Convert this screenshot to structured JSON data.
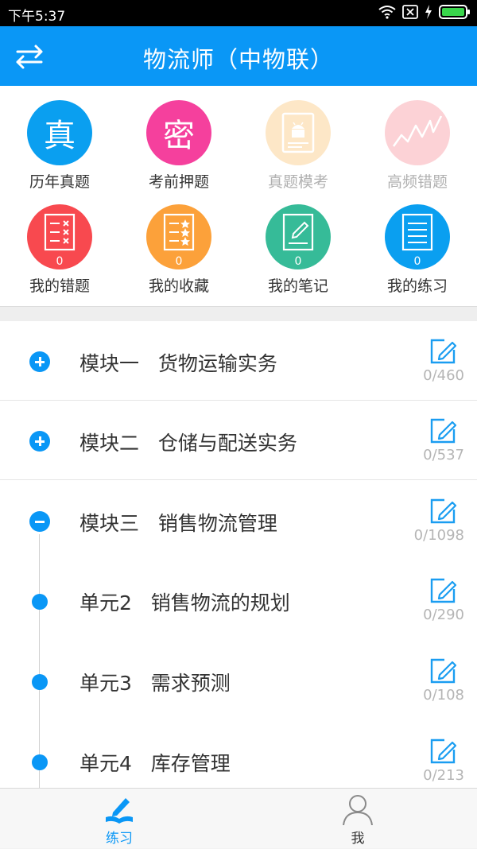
{
  "status": {
    "time": "下午5:37"
  },
  "header": {
    "title": "物流师（中物联）"
  },
  "colors": {
    "accent": "#0a97f6"
  },
  "grid": [
    {
      "label": "历年真题",
      "char": "真",
      "color": "#0a9ff0",
      "disabled": false
    },
    {
      "label": "考前押题",
      "char": "密",
      "color": "#f5409d",
      "disabled": false
    },
    {
      "label": "真题模考",
      "char": "",
      "color": "#fde7c7",
      "disabled": true
    },
    {
      "label": "高频错题",
      "char": "",
      "color": "#fcd2d6",
      "disabled": true
    },
    {
      "label": "我的错题",
      "badge": "0",
      "color": "#f8494f",
      "disabled": false
    },
    {
      "label": "我的收藏",
      "badge": "0",
      "color": "#fca13a",
      "disabled": false
    },
    {
      "label": "我的笔记",
      "badge": "0",
      "color": "#36bb98",
      "disabled": false
    },
    {
      "label": "我的练习",
      "badge": "0",
      "color": "#0a9ff0",
      "disabled": false
    }
  ],
  "modules": [
    {
      "label": "模块一   货物运输实务",
      "count": "0/460",
      "state": "plus"
    },
    {
      "label": "模块二   仓储与配送实务",
      "count": "0/537",
      "state": "plus"
    },
    {
      "label": "模块三   销售物流管理",
      "count": "0/1098",
      "state": "minus"
    },
    {
      "label": "单元2   销售物流的规划",
      "count": "0/290",
      "state": "dot"
    },
    {
      "label": "单元3   需求预测",
      "count": "0/108",
      "state": "dot"
    },
    {
      "label": "单元4   库存管理",
      "count": "0/213",
      "state": "dot"
    }
  ],
  "tabs": [
    {
      "label": "练习",
      "active": true
    },
    {
      "label": "我",
      "active": false
    }
  ]
}
